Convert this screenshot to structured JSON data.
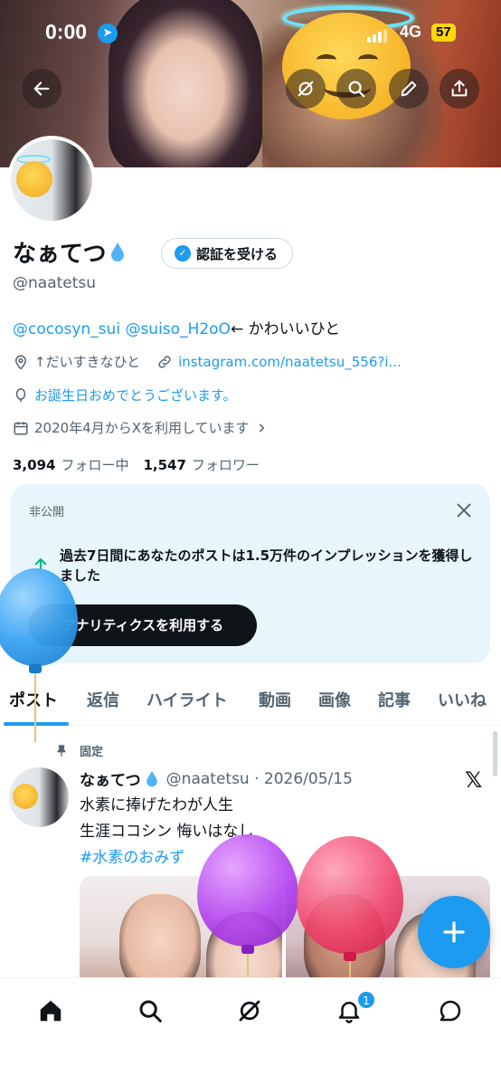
{
  "status_bar": {
    "time": "0:00",
    "network": "4G",
    "battery": "57"
  },
  "profile": {
    "name": "なぁてつ",
    "handle": "@naatetsu",
    "verify_button": "認証を受ける",
    "bio_mentions": "@cocosyn_sui @suiso_H2oO",
    "bio_text": "← かわいいひと",
    "location": "↑だいすきなひと",
    "link": "instagram.com/naatetsu_556?i...",
    "birthday": "お誕生日おめでとうございます。",
    "joined": "2020年4月からXを利用しています",
    "following_count": "3,094",
    "following_label": "フォロー中",
    "followers_count": "1,547",
    "followers_label": "フォロワー"
  },
  "analytics_card": {
    "label": "非公開",
    "message": "過去7日間にあなたのポストは1.5万件のインプレッションを獲得しました",
    "cta": "アナリティクスを利用する"
  },
  "tabs": [
    "ポスト",
    "返信",
    "ハイライト",
    "動画",
    "画像",
    "記事",
    "いいね"
  ],
  "pinned_tweet": {
    "pinned_label": "固定",
    "name": "なぁてつ",
    "meta": "@naatetsu · 2026/05/15",
    "line1": "水素に捧げたわが人生",
    "line2": "生涯ココシン  悔いはなし",
    "hashtag": "#水素のおみず"
  },
  "bottom_nav": {
    "notification_count": "1"
  },
  "colors": {
    "accent": "#1d9bf0",
    "text": "#0f1419",
    "secondary": "#536471",
    "card_bg": "#e8f5fd"
  }
}
